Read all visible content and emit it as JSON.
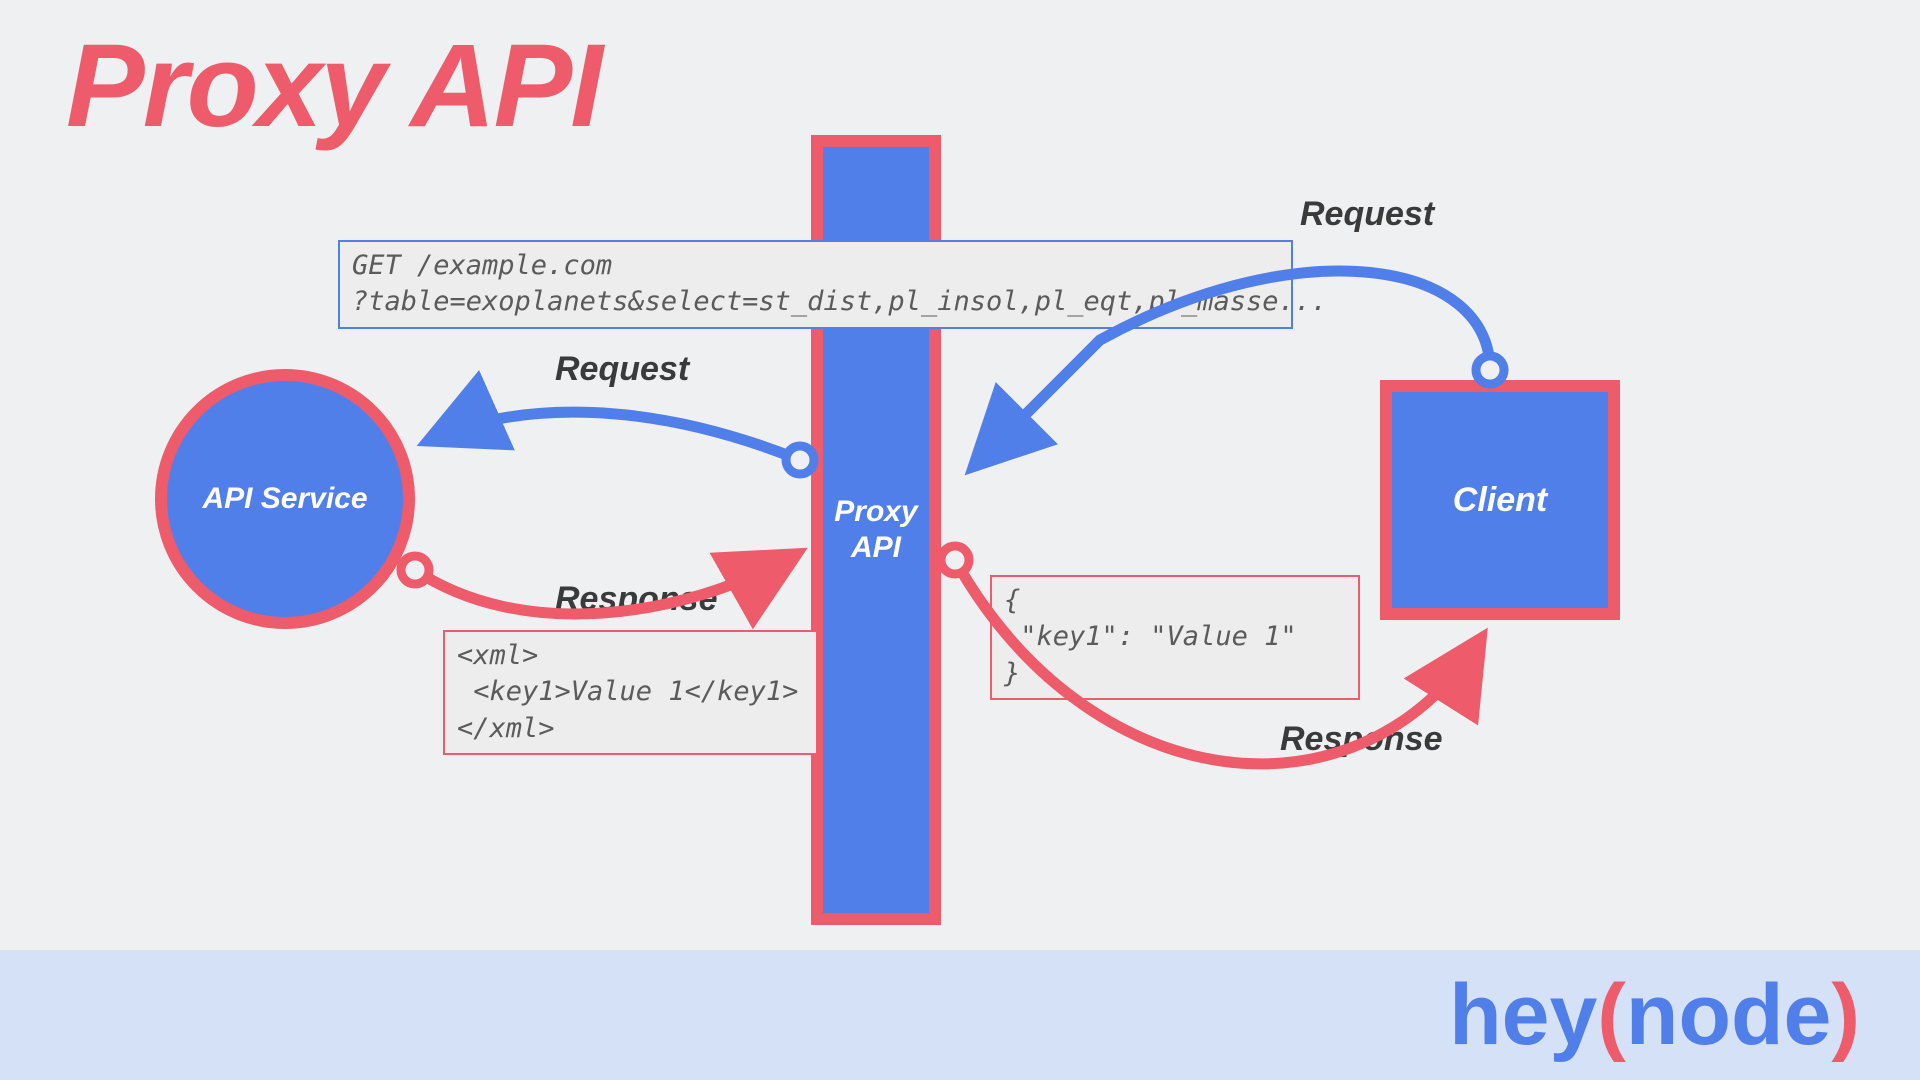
{
  "title": "Proxy API",
  "nodes": {
    "api_service": "API Service",
    "proxy_api": "Proxy\nAPI",
    "client": "Client"
  },
  "labels": {
    "request_top_left": "Request",
    "request_top_right": "Request",
    "response_bottom_left": "Response",
    "response_bottom_right": "Response"
  },
  "code": {
    "http_request": "GET /example.com\n?table=exoplanets&select=st_dist,pl_insol,pl_eqt,pl_masse...",
    "xml_response": "<xml>\n <key1>Value 1</key1>\n</xml>",
    "json_response": "{\n \"key1\": \"Value 1\"\n}"
  },
  "brand": {
    "prefix": "hey",
    "open": "(",
    "mid": "node",
    "close": ")"
  },
  "colors": {
    "blue": "#517fea",
    "red": "#ee5b6a",
    "bg": "#eff0f1",
    "footer": "#d5e1f6",
    "codebg": "#ededed",
    "text": "#3a3a3a"
  }
}
